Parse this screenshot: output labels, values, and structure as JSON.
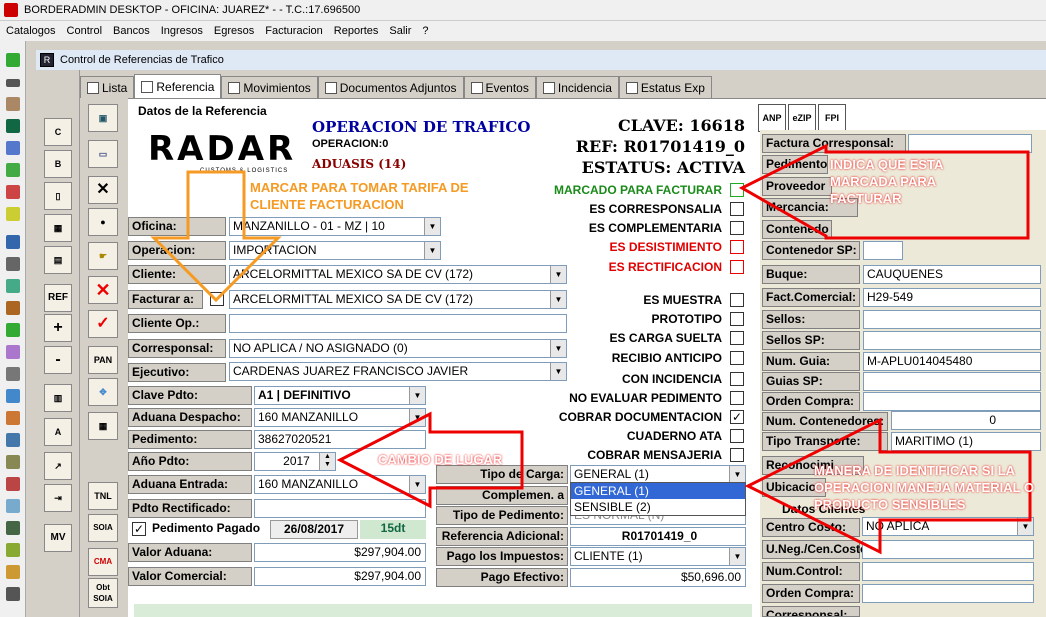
{
  "window": {
    "title": "BORDERADMIN DESKTOP - OFICINA: JUAREZ* -  - T.C.:17.696500"
  },
  "menu": [
    "Catalogos",
    "Control",
    "Bancos",
    "Ingresos",
    "Egresos",
    "Facturacion",
    "Reportes",
    "Salir",
    "?"
  ],
  "child": {
    "title": "Control de Referencias de Trafico"
  },
  "tabs": [
    "Lista",
    "Referencia",
    "Movimientos",
    "Documentos Adjuntos",
    "Eventos",
    "Incidencia",
    "Estatus Exp"
  ],
  "section_title": "Datos de la Referencia",
  "logo": {
    "text": "RADAR",
    "sub": "CUSTOMS & LOGISTICS"
  },
  "header": {
    "op_title": "OPERACION DE TRAFICO",
    "operacion": "OPERACION:0",
    "aduasis": "ADUASIS (14)",
    "clave": "CLAVE: 16618",
    "ref": "REF: R01701419_0",
    "estatus": "ESTATUS: ACTIVA"
  },
  "form": {
    "oficina_l": "Oficina:",
    "oficina_v": "MANZANILLO - 01 - MZ | 10",
    "operacion_l": "Operacion:",
    "operacion_v": "IMPORTACION",
    "cliente_l": "Cliente:",
    "cliente_v": "ARCELORMITTAL MEXICO SA DE CV (172)",
    "facturar_l": "Facturar a:",
    "facturar_v": "ARCELORMITTAL MEXICO SA DE CV (172)",
    "clienteop_l": "Cliente Op.:",
    "corresponsal_l": "Corresponsal:",
    "corresponsal_v": "NO APLICA / NO ASIGNADO (0)",
    "ejecutivo_l": "Ejecutivo:",
    "ejecutivo_v": "CARDENAS JUAREZ FRANCISCO JAVIER",
    "clavepdto_l": "Clave Pdto:",
    "clavepdto_v": "A1 | DEFINITIVO",
    "aduanadesp_l": "Aduana Despacho:",
    "aduanadesp_v": "160 MANZANILLO",
    "pedimento_l": "Pedimento:",
    "pedimento_v": "38627020521",
    "anopdto_l": "Año Pdto:",
    "anopdto_v": "2017",
    "aduanaent_l": "Aduana Entrada:",
    "aduanaent_v": "160 MANZANILLO",
    "pdtorect_l": "Pdto Rectificado:",
    "pedpagado_l": "Pedimento Pagado",
    "pedpagado_fecha": "26/08/2017",
    "pedpagado_dt": "15dt",
    "valoraduana_l": "Valor Aduana:",
    "valoraduana_v": "$297,904.00",
    "valorcomercial_l": "Valor Comercial:",
    "valorcomercial_v": "$297,904.00"
  },
  "flags": [
    {
      "label": "MARCADO PARA FACTURAR",
      "color": "#1a8a1a",
      "checked": ""
    },
    {
      "label": "ES CORRESPONSALIA",
      "color": "#000",
      "checked": ""
    },
    {
      "label": "ES COMPLEMENTARIA",
      "color": "#000",
      "checked": ""
    },
    {
      "label": "ES DESISTIMIENTO",
      "color": "#e00000",
      "checked": ""
    },
    {
      "label": "ES RECTIFICACION",
      "color": "#e00000",
      "checked": ""
    }
  ],
  "flags2": [
    {
      "label": "ES MUESTRA",
      "checked": ""
    },
    {
      "label": "PROTOTIPO",
      "checked": ""
    },
    {
      "label": "ES CARGA SUELTA",
      "checked": ""
    },
    {
      "label": "RECIBIO ANTICIPO",
      "checked": ""
    },
    {
      "label": "CON INCIDENCIA",
      "checked": ""
    },
    {
      "label": "NO EVALUAR PEDIMENTO",
      "checked": ""
    },
    {
      "label": "COBRAR DOCUMENTACION",
      "checked": "✓"
    },
    {
      "label": "CUADERNO ATA",
      "checked": ""
    },
    {
      "label": "COBRAR MENSAJERIA",
      "checked": ""
    }
  ],
  "mid": {
    "tipocarga_l": "Tipo de Carga:",
    "tipocarga_v": "GENERAL (1)",
    "opt1": "GENERAL (1)",
    "opt2": "SENSIBLE (2)",
    "complemen_l": "Complemen. a Cargo:",
    "tipoped_l": "Tipo de Pedimento:",
    "tipoped_v": "ES NORMAL (N)",
    "refad_l": "Referencia Adicional:",
    "refad_v": "R01701419_0",
    "pagoimp_l": "Pago los Impuestos:",
    "pagoimp_v": "CLIENTE (1)",
    "pagoefe_l": "Pago Efectivo:",
    "pagoefe_v": "$50,696.00"
  },
  "topbtns": [
    "ANP",
    "eZIP",
    "FPI"
  ],
  "right": {
    "factcorr_l": "Factura Corresponsal:",
    "pedimento_l": "Pedimento",
    "proveedor_l": "Proveedor",
    "mercancia_l": "Mercancia:",
    "contenedor_l": "Contenedo",
    "contenedorsp_l": "Contenedor SP:",
    "buque_l": "Buque:",
    "buque_v": "CAUQUENES",
    "factcom_l": "Fact.Comercial:",
    "factcom_v": "H29-549",
    "sellos_l": "Sellos:",
    "sellossp_l": "Sellos SP:",
    "numguia_l": "Num. Guia:",
    "numguia_v": "M-APLU014045480",
    "guiassp_l": "Guias SP:",
    "ordencompra_l": "Orden Compra:",
    "numcont_l": "Num. Contenedores:",
    "numcont_v": "0",
    "tipotransp_l": "Tipo Transporte:",
    "tipotransp_v": "MARITIMO (1)",
    "reconoc_l": "Reconocimi",
    "ubicacion_l": "Ubicacio",
    "datos_l": "Datos Clientes",
    "centrocosto_l": "Centro Costo:",
    "centrocosto_v": "NO APLICA",
    "uneg_l": "U.Neg./Cen.Costo:",
    "numcontrol_l": "Num.Control:",
    "ordencompra2_l": "Orden Compra:",
    "corresponsal_l": "Corresponsal:"
  },
  "left_btns": [
    "REF",
    "+",
    "-",
    "PAN",
    "TNL",
    "SOIA",
    "CMA",
    "Obt SOIA",
    "MV"
  ],
  "annotations": {
    "a1": "MARCAR PARA TOMAR TARIFA DE CLIENTE FACTURACION",
    "a2": "INDICA QUE ESTA MARCADA PARA FACTURAR",
    "a3": "CAMBIO DE LUGAR",
    "a4": "MANERA DE IDENTIFICAR SI LA OPERACION MANEJA MATERIAL O PRODUCTO SENSIBLES"
  }
}
